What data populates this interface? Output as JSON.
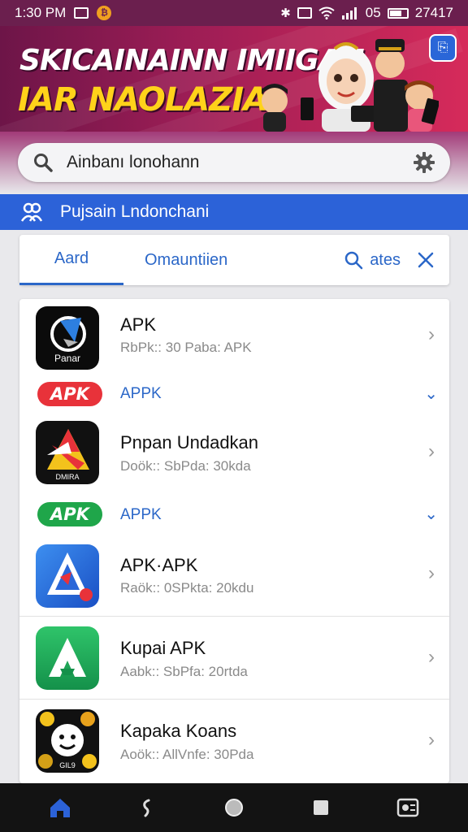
{
  "status_bar": {
    "time": "1:30 PM",
    "right_text": "05",
    "battery_text": "27417"
  },
  "banner": {
    "title_line1": "SKICAINAINN IMIIGAN",
    "title_line2": "IAR NAOLAZIA"
  },
  "search": {
    "text": "Ainbanı lonohann"
  },
  "user_bar": {
    "label": "Pujsain Lndonchani"
  },
  "tabs": {
    "items": [
      "Aard",
      "Omauntiien"
    ],
    "search_label": "ates"
  },
  "apps": [
    {
      "title": "APK",
      "subtitle": "RbPk:: 30 Paba: APK",
      "icon_text": "Panar"
    },
    {
      "badge": "APK",
      "label": "APPK",
      "badge_color": "#e8323a"
    },
    {
      "title": "Pnpan Undadkan",
      "subtitle": "Doök:: SbPda: 30kda",
      "icon_text": "DMIRA"
    },
    {
      "badge": "APK",
      "label": "APPK",
      "badge_color": "#1fa64a"
    },
    {
      "title": "APK·APK",
      "subtitle": "Raök:: 0SPkta: 20kdu"
    },
    {
      "title": "Kupai APK",
      "subtitle": "Aabk:: SbPfa: 20rtda"
    },
    {
      "title": "Kapaka Koans",
      "subtitle": "Aoök:: AllVnfe: 30Pda",
      "icon_text": "GIL9"
    }
  ],
  "colors": {
    "accent": "#2c62d8",
    "banner": "#9c1d55",
    "title_yellow": "#ffd21a"
  }
}
